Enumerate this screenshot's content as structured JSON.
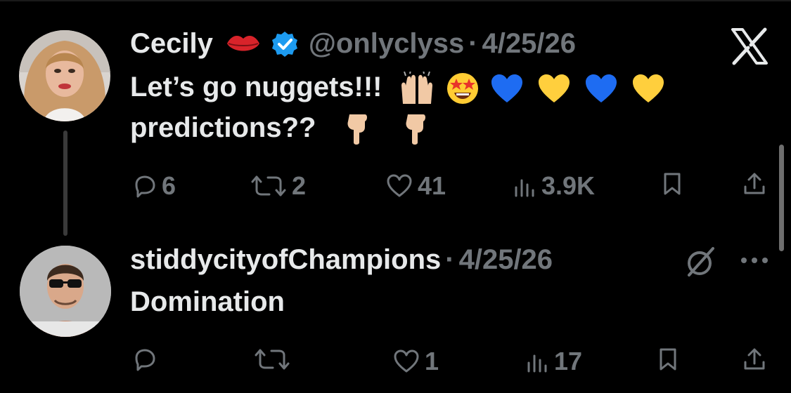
{
  "colors": {
    "background": "#000000",
    "text": "#e7e9ea",
    "muted": "#71767b",
    "verified": "#1d9bf0"
  },
  "tweet": {
    "author_name": "Cecily",
    "handle": "@onlyclyss",
    "separator": "·",
    "date": "4/25/26",
    "line1": "Let’s go nuggets!!!",
    "line2": "predictions??",
    "emojis_line1": [
      "raised-hands",
      "star-struck",
      "blue-heart",
      "yellow-heart",
      "blue-heart",
      "yellow-heart"
    ],
    "emojis_line2": [
      "pointing-down",
      "pointing-down"
    ],
    "stats": {
      "replies": "6",
      "reposts": "2",
      "likes": "41",
      "views": "3.9K"
    }
  },
  "reply": {
    "author_name": "stiddycityofChampions",
    "separator": "·",
    "date": "4/25/26",
    "text": "Domination",
    "stats": {
      "replies": "",
      "reposts": "",
      "likes": "1",
      "views": "17"
    }
  },
  "icons": [
    "x-logo-icon",
    "lips-icon",
    "verified-badge-icon",
    "reply-icon",
    "repost-icon",
    "like-icon",
    "views-icon",
    "bookmark-icon",
    "share-icon",
    "grok-icon",
    "more-icon"
  ]
}
